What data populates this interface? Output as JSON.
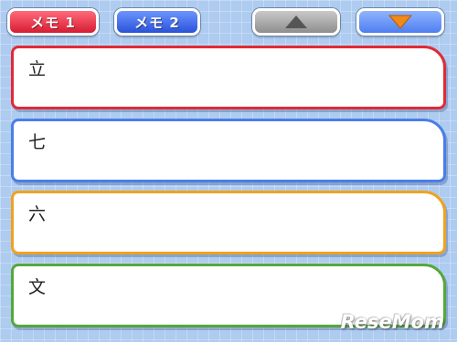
{
  "tabs": {
    "memo1_label": "メモ 1",
    "memo2_label": "メモ 2"
  },
  "nav": {
    "up_icon": "triangle-up-icon",
    "down_icon": "triangle-down-icon"
  },
  "memos": [
    {
      "text": "立",
      "border_color": "#e12a36"
    },
    {
      "text": "七",
      "border_color": "#4a7ee8"
    },
    {
      "text": "六",
      "border_color": "#f0a21e"
    },
    {
      "text": "文",
      "border_color": "#54a83a"
    }
  ],
  "colors": {
    "memo1_tab": "#e0283c",
    "memo2_tab": "#3a62e6",
    "up_button": "#a8a8a8",
    "down_button": "#5f8cf2",
    "down_arrow": "#f08a1a",
    "background": "#aecbf0"
  },
  "watermark": "ReseMom"
}
